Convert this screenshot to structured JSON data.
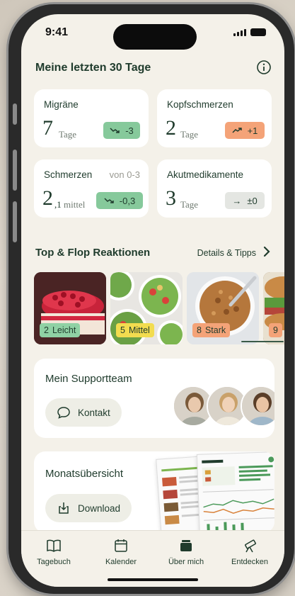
{
  "status_bar": {
    "time": "9:41"
  },
  "header": {
    "title": "Meine letzten 30 Tage"
  },
  "stats": [
    {
      "title": "Migräne",
      "value": "7",
      "unit": "Tage",
      "trend": "down",
      "delta": "-3",
      "tone": "green"
    },
    {
      "title": "Kopfschmerzen",
      "value": "2",
      "unit": "Tage",
      "trend": "up",
      "delta": "+1",
      "tone": "orange"
    },
    {
      "title": "Schmerzen",
      "subtitle": "von 0-3",
      "value": "2",
      "value_decimal": ",1",
      "unit": "mittel",
      "trend": "down",
      "delta": "-0,3",
      "tone": "green"
    },
    {
      "title": "Akutmedikamente",
      "value": "3",
      "unit": "Tage",
      "trend": "flat",
      "delta": "±0",
      "tone": "grey"
    }
  ],
  "reactions": {
    "title": "Top & Flop Reaktionen",
    "link": "Details & Tipps",
    "items": [
      {
        "number": "2",
        "label": "Leicht",
        "color": "#8fd1a4"
      },
      {
        "number": "5",
        "label": "Mittel",
        "color": "#f2dc4f"
      },
      {
        "number": "8",
        "label": "Stark",
        "color": "#f4a378"
      },
      {
        "number": "9",
        "label": "",
        "color": "#f4a378"
      }
    ]
  },
  "support": {
    "title": "Mein Supportteam",
    "button": "Kontakt"
  },
  "overview": {
    "title": "Monatsübersicht",
    "button": "Download"
  },
  "tabs": [
    {
      "label": "Tagebuch",
      "icon": "book-icon"
    },
    {
      "label": "Kalender",
      "icon": "calendar-icon"
    },
    {
      "label": "Über mich",
      "icon": "stack-icon"
    },
    {
      "label": "Entdecken",
      "icon": "telescope-icon"
    }
  ],
  "colors": {
    "accent": "#1f3b2c",
    "background": "#f4f1e9",
    "green": "#86c99b",
    "orange": "#f4a378"
  }
}
